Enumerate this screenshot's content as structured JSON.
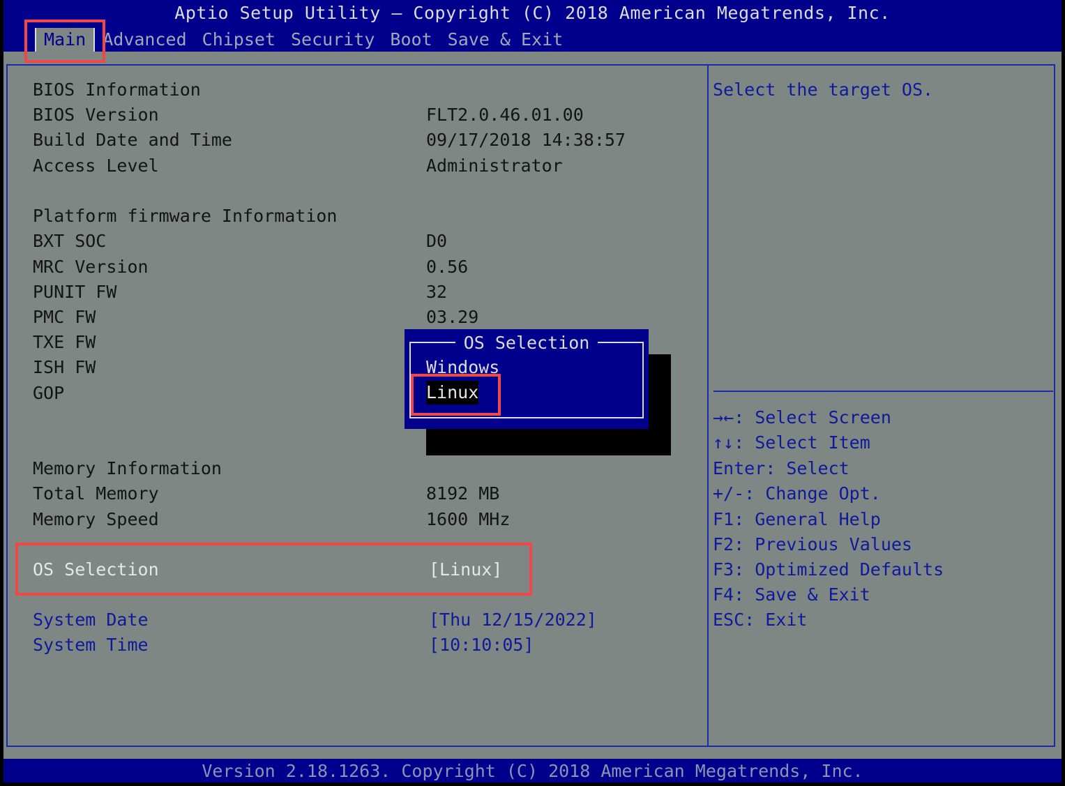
{
  "header": {
    "title": "Aptio Setup Utility – Copyright (C) 2018 American Megatrends, Inc.",
    "tabs": [
      {
        "label": "Main",
        "active": true
      },
      {
        "label": "Advanced"
      },
      {
        "label": "Chipset"
      },
      {
        "label": "Security"
      },
      {
        "label": "Boot"
      },
      {
        "label": "Save & Exit"
      }
    ]
  },
  "main": {
    "bios_info": {
      "heading": "BIOS Information",
      "rows": [
        {
          "label": "BIOS Version",
          "value": "FLT2.0.46.01.00"
        },
        {
          "label": "Build Date and Time",
          "value": "09/17/2018 14:38:57"
        },
        {
          "label": "Access Level",
          "value": "Administrator"
        }
      ]
    },
    "platform_info": {
      "heading": "Platform firmware Information",
      "rows": [
        {
          "label": "BXT SOC",
          "value": "D0"
        },
        {
          "label": "MRC Version",
          "value": "0.56"
        },
        {
          "label": "PUNIT FW",
          "value": "32"
        },
        {
          "label": "PMC FW",
          "value": "03.29"
        },
        {
          "label": "TXE FW",
          "value": ""
        },
        {
          "label": "ISH FW",
          "value": ""
        },
        {
          "label": "GOP",
          "value": ""
        }
      ]
    },
    "memory_info": {
      "heading": "Memory Information",
      "rows": [
        {
          "label": "Total Memory",
          "value": "8192 MB"
        },
        {
          "label": "Memory Speed",
          "value": "1600 MHz"
        }
      ]
    },
    "os_selection": {
      "label": "OS Selection",
      "value": "[Linux]"
    },
    "system_date": {
      "label": "System Date",
      "value": "[Thu 12/15/2022]"
    },
    "system_time": {
      "label": "System Time",
      "value": "[10:10:05]"
    }
  },
  "popup": {
    "title": "OS Selection",
    "options": [
      {
        "label": "Windows"
      },
      {
        "label": "Linux",
        "selected": true
      }
    ]
  },
  "help": {
    "description": "Select the target OS.",
    "keys": [
      "→←: Select Screen",
      "↑↓: Select Item",
      "Enter: Select",
      "+/-: Change Opt.",
      "F1: General Help",
      "F2: Previous Values",
      "F3: Optimized Defaults",
      "F4: Save & Exit",
      "ESC: Exit"
    ]
  },
  "footer": {
    "text": "Version 2.18.1263. Copyright (C) 2018 American Megatrends, Inc."
  },
  "colors": {
    "header_bg": "#00008c",
    "panel_bg": "#7f8785",
    "highlight": "#f04848",
    "selectable_text": "#0e1a9a"
  }
}
